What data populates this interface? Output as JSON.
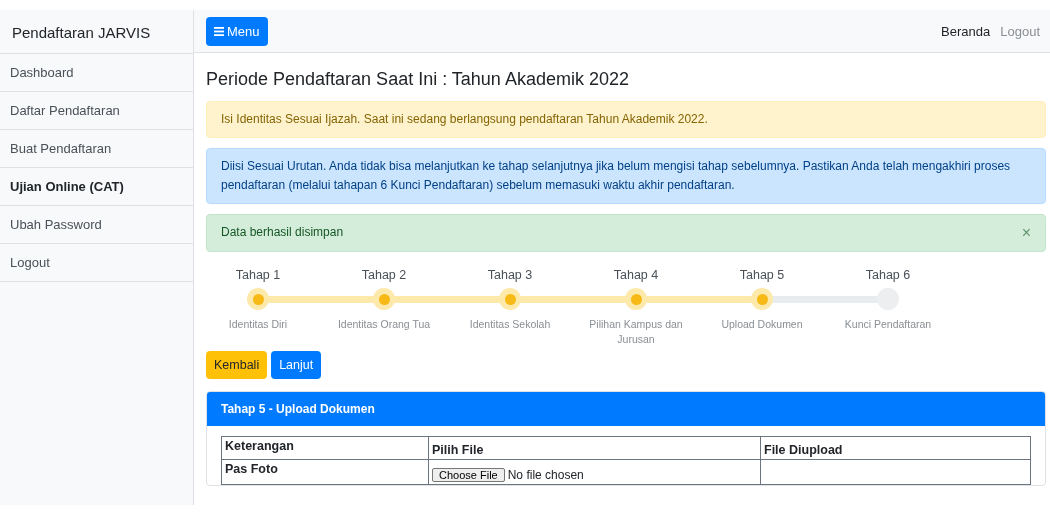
{
  "sidebar": {
    "title": "Pendaftaran JARVIS",
    "items": [
      {
        "label": "Dashboard",
        "selected": false
      },
      {
        "label": "Daftar Pendaftaran",
        "selected": false
      },
      {
        "label": "Buat Pendaftaran",
        "selected": false
      },
      {
        "label": "Ujian Online (CAT)",
        "selected": true
      },
      {
        "label": "Ubah Password",
        "selected": false
      },
      {
        "label": "Logout",
        "selected": false
      }
    ]
  },
  "navbar": {
    "menu_button": "Menu",
    "links": [
      {
        "label": "Beranda",
        "selected": true
      },
      {
        "label": "Logout",
        "selected": false
      }
    ]
  },
  "page_title": "Periode Pendaftaran Saat Ini : Tahun Akademik 2022",
  "alerts": [
    {
      "kind": "warning",
      "text": "Isi Identitas Sesuai Ijazah. Saat ini sedang berlangsung pendaftaran Tahun Akademik 2022."
    },
    {
      "kind": "info",
      "text": "Diisi Sesuai Urutan. Anda tidak bisa melanjutkan ke tahap selanjutnya jika belum mengisi tahap sebelumnya. Pastikan Anda telah mengakhiri proses pendaftaran (melalui tahapan 6 Kunci Pendaftaran) sebelum memasuki waktu akhir pendaftaran."
    },
    {
      "kind": "success",
      "text": "Data berhasil disimpan",
      "close": "×"
    }
  ],
  "steps": [
    {
      "title": "Tahap 1",
      "label": "Identitas Diri",
      "done": true
    },
    {
      "title": "Tahap 2",
      "label": "Identitas Orang Tua",
      "done": true
    },
    {
      "title": "Tahap 3",
      "label": "Identitas Sekolah",
      "done": true
    },
    {
      "title": "Tahap 4",
      "label": "Pilihan Kampus dan Jurusan",
      "done": true
    },
    {
      "title": "Tahap 5",
      "label": "Upload Dokumen",
      "done": true
    },
    {
      "title": "Tahap 6",
      "label": "Kunci Pendaftaran",
      "done": false
    }
  ],
  "buttons": [
    {
      "kind": "warning",
      "label": "Kembali"
    },
    {
      "kind": "primary",
      "label": "Lanjut"
    }
  ],
  "card": {
    "title": "Tahap 5 - Upload Dokumen",
    "table": {
      "columns": [
        "Keterangan",
        "Pilih File",
        "File Diupload"
      ],
      "rows": [
        {
          "keterangan": "Pas Foto",
          "file_button": "Choose File",
          "file_status": "No file chosen"
        }
      ]
    }
  }
}
